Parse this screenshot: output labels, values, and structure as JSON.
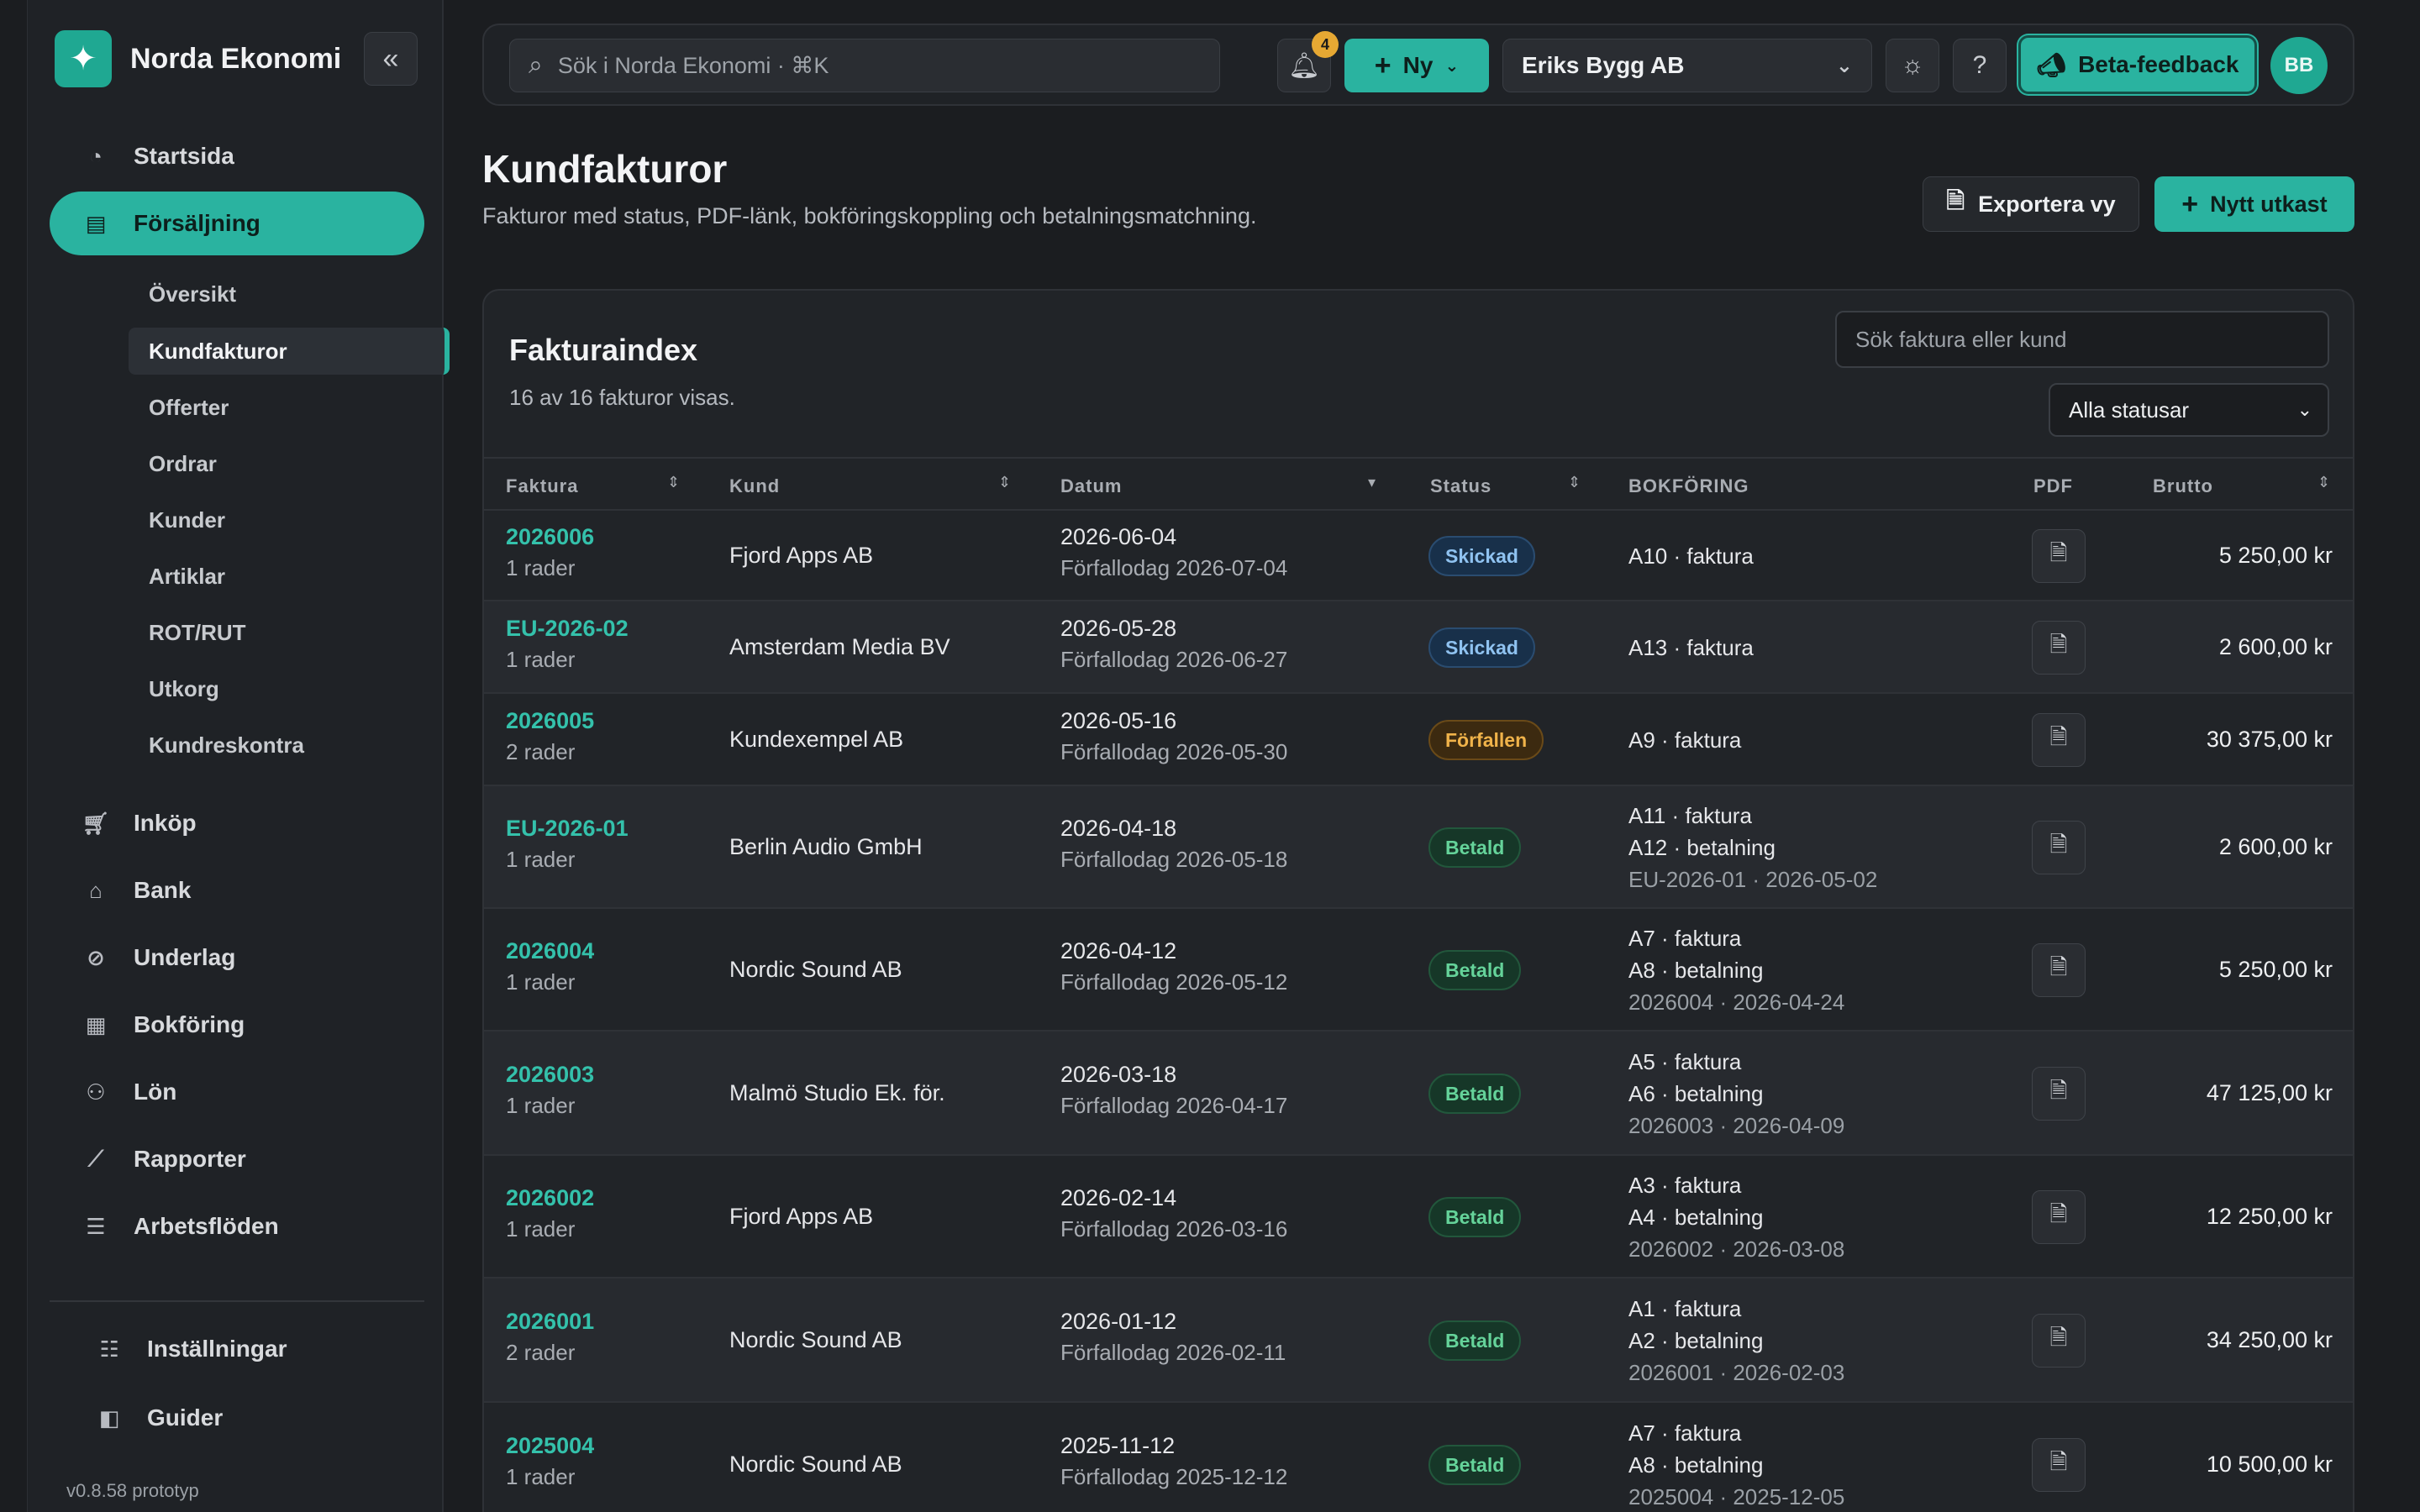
{
  "brand": {
    "name": "Norda Ekonomi"
  },
  "sidebar": {
    "items": [
      {
        "label": "Startsida",
        "icon": "dashboard-icon"
      },
      {
        "label": "Försäljning",
        "icon": "invoice-icon"
      },
      {
        "label": "Inköp",
        "icon": "cart-icon"
      },
      {
        "label": "Bank",
        "icon": "bank-icon"
      },
      {
        "label": "Underlag",
        "icon": "paperclip-icon"
      },
      {
        "label": "Bokföring",
        "icon": "ledger-icon"
      },
      {
        "label": "Lön",
        "icon": "people-icon"
      },
      {
        "label": "Rapporter",
        "icon": "chart-icon"
      },
      {
        "label": "Arbetsflöden",
        "icon": "list-icon"
      }
    ],
    "sub_items": [
      "Översikt",
      "Kundfakturor",
      "Offerter",
      "Ordrar",
      "Kunder",
      "Artiklar",
      "ROT/RUT",
      "Utkorg",
      "Kundreskontra"
    ],
    "footer_items": [
      {
        "label": "Inställningar",
        "icon": "sliders-icon"
      },
      {
        "label": "Guider",
        "icon": "book-icon"
      }
    ],
    "version": "v0.8.58 prototyp"
  },
  "topbar": {
    "search_placeholder": "Sök i Norda Ekonomi · ⌘K",
    "notification_count": "4",
    "new_label": "Ny",
    "company": "Eriks Bygg AB",
    "feedback_label": "Beta-feedback",
    "avatar_initials": "BB"
  },
  "page": {
    "title": "Kundfakturor",
    "subtitle": "Fakturor med status, PDF-länk, bokföringskoppling och betalningsmatchning.",
    "export_label": "Exportera vy",
    "draft_label": "Nytt utkast"
  },
  "index": {
    "title": "Fakturaindex",
    "count": "16 av 16 fakturor visas.",
    "search_placeholder": "Sök faktura eller kund",
    "status_filter": "Alla statusar",
    "columns": {
      "invoice": "Faktura",
      "customer": "Kund",
      "date": "Datum",
      "status": "Status",
      "booking": "BOKFÖRING",
      "pdf": "PDF",
      "gross": "Brutto"
    },
    "rows": [
      {
        "invoice": "2026006",
        "rows": "1 rader",
        "customer": "Fjord Apps AB",
        "date": "2026-06-04",
        "due": "Förfallodag 2026-07-04",
        "status": "Skickad",
        "status_kind": "sent",
        "booking": [
          "A10 · faktura"
        ],
        "match": "",
        "gross": "5 250,00 kr"
      },
      {
        "invoice": "EU-2026-02",
        "rows": "1 rader",
        "customer": "Amsterdam Media BV",
        "date": "2026-05-28",
        "due": "Förfallodag 2026-06-27",
        "status": "Skickad",
        "status_kind": "sent",
        "booking": [
          "A13 · faktura"
        ],
        "match": "",
        "gross": "2 600,00 kr"
      },
      {
        "invoice": "2026005",
        "rows": "2 rader",
        "customer": "Kundexempel AB",
        "date": "2026-05-16",
        "due": "Förfallodag 2026-05-30",
        "status": "Förfallen",
        "status_kind": "overdue",
        "booking": [
          "A9 · faktura"
        ],
        "match": "",
        "gross": "30 375,00 kr"
      },
      {
        "invoice": "EU-2026-01",
        "rows": "1 rader",
        "customer": "Berlin Audio GmbH",
        "date": "2026-04-18",
        "due": "Förfallodag 2026-05-18",
        "status": "Betald",
        "status_kind": "paid",
        "booking": [
          "A11 · faktura",
          "A12 · betalning"
        ],
        "match": "EU-2026-01 · 2026-05-02",
        "gross": "2 600,00 kr"
      },
      {
        "invoice": "2026004",
        "rows": "1 rader",
        "customer": "Nordic Sound AB",
        "date": "2026-04-12",
        "due": "Förfallodag 2026-05-12",
        "status": "Betald",
        "status_kind": "paid",
        "booking": [
          "A7 · faktura",
          "A8 · betalning"
        ],
        "match": "2026004 · 2026-04-24",
        "gross": "5 250,00 kr"
      },
      {
        "invoice": "2026003",
        "rows": "1 rader",
        "customer": "Malmö Studio Ek. för.",
        "date": "2026-03-18",
        "due": "Förfallodag 2026-04-17",
        "status": "Betald",
        "status_kind": "paid",
        "booking": [
          "A5 · faktura",
          "A6 · betalning"
        ],
        "match": "2026003 · 2026-04-09",
        "gross": "47 125,00 kr"
      },
      {
        "invoice": "2026002",
        "rows": "1 rader",
        "customer": "Fjord Apps AB",
        "date": "2026-02-14",
        "due": "Förfallodag 2026-03-16",
        "status": "Betald",
        "status_kind": "paid",
        "booking": [
          "A3 · faktura",
          "A4 · betalning"
        ],
        "match": "2026002 · 2026-03-08",
        "gross": "12 250,00 kr"
      },
      {
        "invoice": "2026001",
        "rows": "2 rader",
        "customer": "Nordic Sound AB",
        "date": "2026-01-12",
        "due": "Förfallodag 2026-02-11",
        "status": "Betald",
        "status_kind": "paid",
        "booking": [
          "A1 · faktura",
          "A2 · betalning"
        ],
        "match": "2026001 · 2026-02-03",
        "gross": "34 250,00 kr"
      },
      {
        "invoice": "2025004",
        "rows": "1 rader",
        "customer": "Nordic Sound AB",
        "date": "2025-11-12",
        "due": "Förfallodag 2025-12-12",
        "status": "Betald",
        "status_kind": "paid",
        "booking": [
          "A7 · faktura",
          "A8 · betalning"
        ],
        "match": "2025004 · 2025-12-05",
        "gross": "10 500,00 kr"
      }
    ]
  },
  "colors": {
    "accent": "#2ab3a0",
    "background": "#1b1d20",
    "panel": "#1f2226"
  }
}
